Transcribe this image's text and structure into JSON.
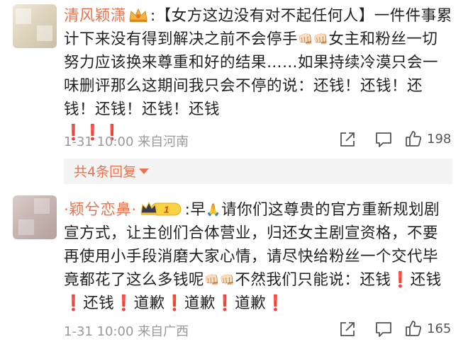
{
  "comments": [
    {
      "username": "清风颖潇",
      "text_parts": [
        ":【女方这边没有对不起任何人】一件件事累计下来没有得到解决之前不会停手",
        "女主和粉丝一切努力应该换来尊重和好的结果……如果持续冷漠只会一味删评那么这期间我只会不停的说：还钱！还钱！还钱！还钱！还钱！还钱"
      ],
      "emoji_fist": "👊🏻👊🏻",
      "bangs": "❗❗❗",
      "date": "1-31 10:00",
      "location": "来自河南",
      "like_count": "198",
      "replies_label": "共4条回复"
    },
    {
      "username": "·颖兮恋鼻·",
      "level_badge": "1",
      "text_parts": {
        "a": ":早",
        "b": "请你们这尊贵的官方重新规划剧宣方式，让主创们合体营业，归还女主剧宣资格，不要再使用小手段消磨大家心情，请尽快给粉丝一个交代毕竟都花了这么多钱呢",
        "c": "不然我们只能说：还钱",
        "d": "还钱",
        "e": "还钱",
        "f": "道歉",
        "g": "道歉",
        "h": "道歉"
      },
      "emoji_pray": "🙏",
      "emoji_fist": "👊🏻👊🏻",
      "bang": "❗",
      "date": "1-31 10:00",
      "location": "来自广西",
      "like_count": "165"
    }
  ],
  "icons": {
    "share": "share-icon",
    "comment": "comment-icon",
    "like": "thumbs-up-icon"
  },
  "colors": {
    "username": "#eb7350",
    "meta": "#999999",
    "exclamation": "#e0302a",
    "reply_bg": "#f4f4f4"
  }
}
